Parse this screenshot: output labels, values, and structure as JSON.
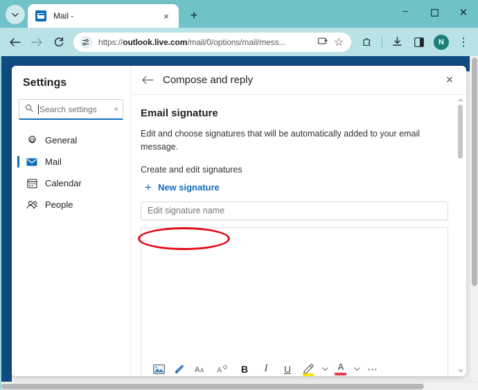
{
  "browser": {
    "tab_search_icon": "chevron-down-icon",
    "tab": {
      "title": "Mail -",
      "favicon": "outlook-icon",
      "close_icon": "×"
    },
    "new_tab_label": "+",
    "window_controls": {
      "minimize": "–",
      "maximize": "☐",
      "close": "✕"
    },
    "nav": {
      "back": "←",
      "forward": "→",
      "reload": "⟳"
    },
    "omnibox": {
      "site_settings_icon": "tune-icon",
      "url_prefix": "https://",
      "url_domain": "outlook.live.com",
      "url_path": "/mail/0/options/mail/mess...",
      "url_full": "https://outlook.live.com/mail/0/options/mail/mess...",
      "cast_icon": "⎘",
      "bookmark_icon": "☆"
    },
    "actions": {
      "extensions_icon": "puzzle-icon",
      "downloads_icon": "⤓",
      "sidepanel_icon": "◧",
      "profile_initial": "N",
      "menu_icon": "⋮"
    }
  },
  "settings": {
    "title": "Settings",
    "search": {
      "placeholder": "Search settings",
      "search_icon": "search-icon",
      "clear_icon": "×"
    },
    "nav_items": [
      {
        "label": "General",
        "icon": "gear-icon",
        "active": false
      },
      {
        "label": "Mail",
        "icon": "mail-icon",
        "active": true
      },
      {
        "label": "Calendar",
        "icon": "calendar-icon",
        "active": false
      },
      {
        "label": "People",
        "icon": "people-icon",
        "active": false
      }
    ]
  },
  "panel": {
    "header": {
      "back_icon": "←",
      "title": "Compose and reply",
      "close_icon": "✕"
    },
    "section_title": "Email signature",
    "section_description": "Edit and choose signatures that will be automatically added to your email message.",
    "subsection_label": "Create and edit signatures",
    "new_signature_button": "New signature",
    "new_signature_plus": "+",
    "signature_name_placeholder": "Edit signature name",
    "editor_toolbar": [
      {
        "name": "insert-picture-icon",
        "glyph": "Ὓc"
      },
      {
        "name": "format-painter-icon",
        "glyph": "brush"
      },
      {
        "name": "font-family-icon",
        "glyph": "AA"
      },
      {
        "name": "font-size-icon",
        "glyph": "A°"
      },
      {
        "name": "bold-icon",
        "glyph": "B"
      },
      {
        "name": "italic-icon",
        "glyph": "I"
      },
      {
        "name": "underline-icon",
        "glyph": "U"
      },
      {
        "name": "highlight-color-icon",
        "glyph": "pen"
      },
      {
        "name": "font-color-icon",
        "glyph": "A"
      },
      {
        "name": "more-options-icon",
        "glyph": "⋯"
      }
    ],
    "toolbar_chevron": "⌄"
  },
  "annotation": {
    "type": "ellipse-highlight",
    "target": "new-signature-button",
    "color": "#e00b18"
  },
  "colors": {
    "browser_chrome": "#6ec2c8",
    "browser_toolbar": "#b9e2e5",
    "outlook_header": "#0f4c81",
    "accent_blue": "#0f6cbd",
    "annotation_red": "#e00b18",
    "highlight_yellow": "#f5e500",
    "font_color_red": "#e8394a"
  }
}
